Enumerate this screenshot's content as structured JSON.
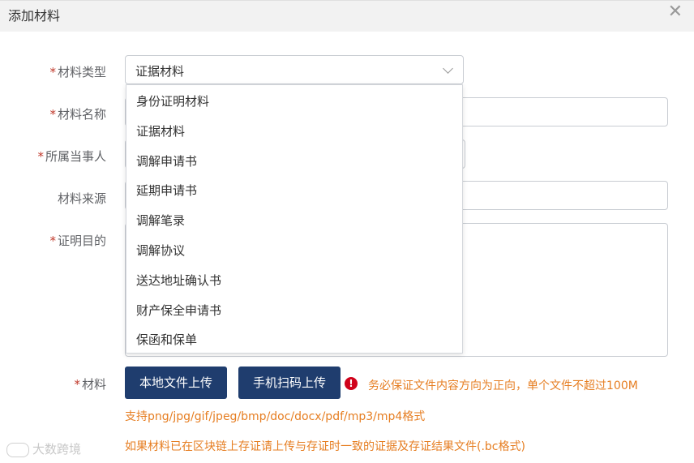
{
  "dialog": {
    "title": "添加材料",
    "close_glyph": "✕"
  },
  "form": {
    "type_label": "材料类型",
    "name_label": "材料名称",
    "party_label": "所属当事人",
    "source_label": "材料来源",
    "purpose_label": "证明目的",
    "material_label": "材料",
    "required_mark": "*",
    "type_value": "证据材料"
  },
  "dropdown": {
    "options": [
      "身份证明材料",
      "证据材料",
      "调解申请书",
      "延期申请书",
      "调解笔录",
      "调解协议",
      "送达地址确认书",
      "财产保全申请书",
      "保函和保单"
    ]
  },
  "upload": {
    "local_button": "本地文件上传",
    "scan_button": "手机扫码上传",
    "warning_icon": "!",
    "warning_text": "务必保证文件内容方向为正向，单个文件不超过100M",
    "formats_text": "支持png/jpg/gif/jpeg/bmp/doc/docx/pdf/mp3/mp4格式",
    "blockchain_text": "如果材料已在区块链上存证请上传与存证时一致的证据及存证结果文件(.bc格式)"
  },
  "watermark": {
    "text": "大数跨境"
  },
  "colors": {
    "primary_button": "#1f3d6e",
    "warning": "#e67e22",
    "required": "#c0392b",
    "error_icon": "#d0021b"
  }
}
